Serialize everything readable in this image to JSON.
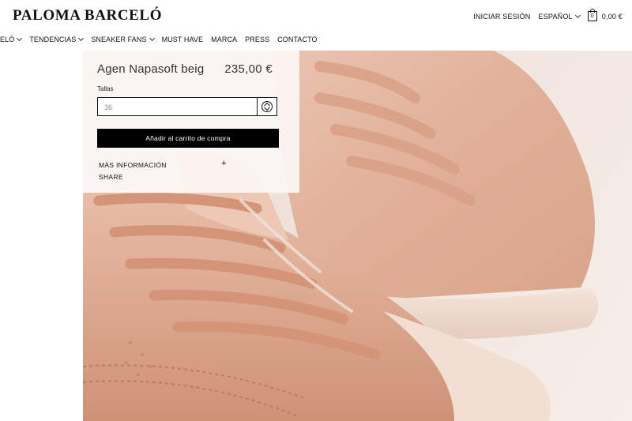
{
  "brand": {
    "logo_text": "PALOMA BARCELÓ"
  },
  "top_nav": {
    "login": "INICIAR SESIÓN",
    "language": "ESPAÑOL",
    "cart_count": "0",
    "cart_total": "0,00 €"
  },
  "main_nav": {
    "items": [
      "ELÓ",
      "TENDENCIAS",
      "SNEAKER FANS",
      "MUST HAVE",
      "MARCA",
      "PRESS",
      "CONTACTO"
    ]
  },
  "product": {
    "name": "Agen Napasoft beig",
    "price": "235,00 €",
    "size_label": "Tallas",
    "size_value": "36",
    "add_to_cart": "Añadir al carrito de compra",
    "more_info": "MÁS INFORMACIÓN",
    "more_info_toggle": "+",
    "share": "SHARE"
  },
  "icons": {
    "cart": "shopping-bag-icon",
    "select": "up-down-arrows-icon",
    "dropdown": "chevron-down-icon"
  },
  "colors": {
    "accent": "#000000",
    "panel_bg": "#fcf6f4",
    "shoe": "#e4b39c"
  }
}
